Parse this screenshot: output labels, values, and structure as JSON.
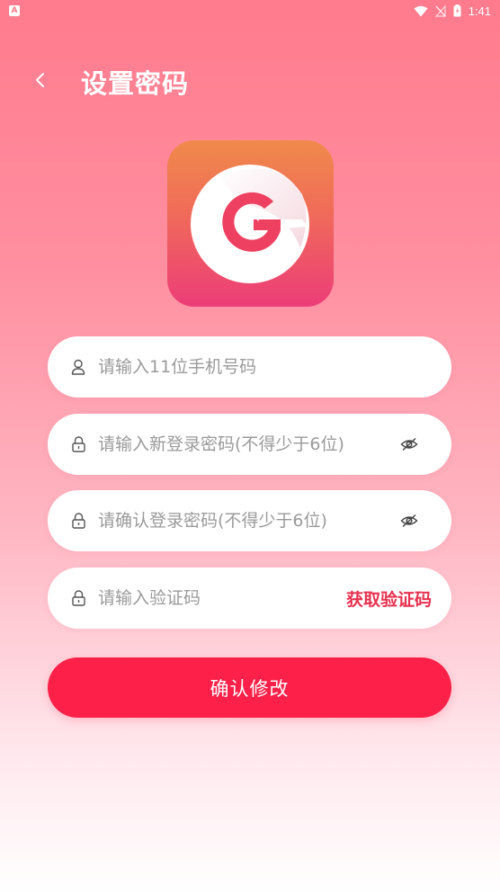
{
  "status_bar": {
    "notification_icon": "A",
    "time": "1:41",
    "icons": [
      "wifi-icon",
      "signal-icon",
      "battery-icon"
    ]
  },
  "header": {
    "back_icon": "chevron-left-icon",
    "title": "设置密码"
  },
  "logo": {
    "icon": "app-logo-g"
  },
  "form": {
    "phone": {
      "placeholder": "请输入11位手机号码",
      "icon": "user-icon"
    },
    "new_password": {
      "placeholder": "请输入新登录密码(不得少于6位)",
      "icon": "lock-icon",
      "toggle_icon": "eye-hidden-icon"
    },
    "confirm_password": {
      "placeholder": "请确认登录密码(不得少于6位)",
      "icon": "lock-icon",
      "toggle_icon": "eye-hidden-icon"
    },
    "code": {
      "placeholder": "请输入验证码",
      "icon": "lock-icon",
      "get_code_label": "获取验证码"
    }
  },
  "submit_label": "确认修改",
  "colors": {
    "accent": "#fd2049",
    "link": "#e8304f",
    "bg_top": "#ff7b8d",
    "bg_bottom": "#ffffff"
  }
}
